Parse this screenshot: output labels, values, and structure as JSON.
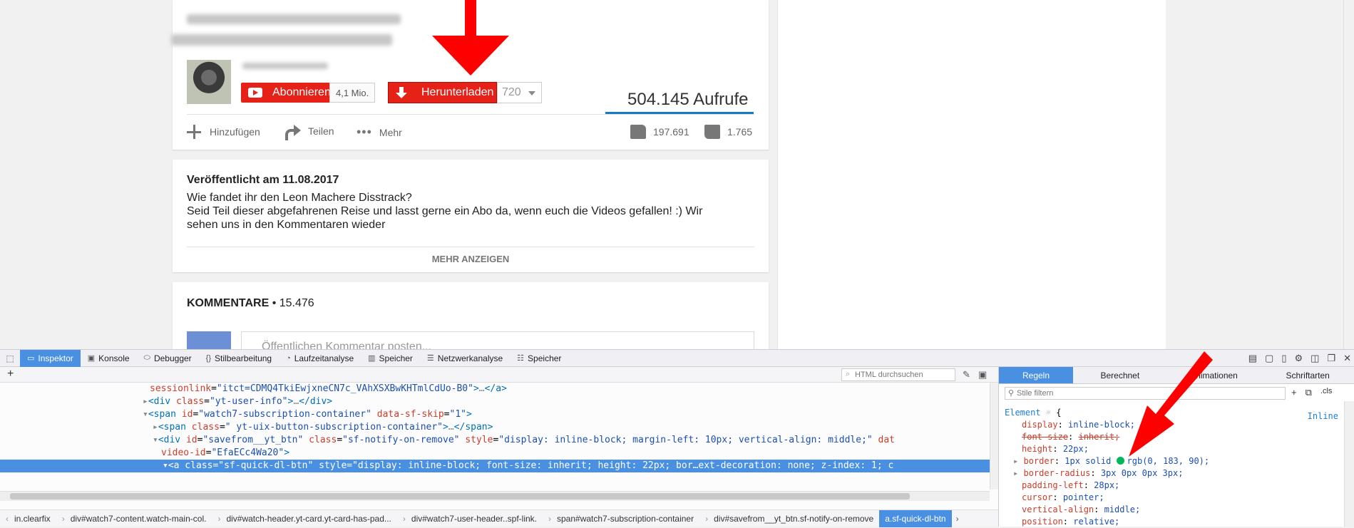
{
  "video": {
    "subscribe_label": "Abonnieren",
    "subscriber_count": "4,1 Mio.",
    "download_label": "Herunterladen",
    "quality": "720",
    "views": "504.145 Aufrufe",
    "actions": {
      "add": "Hinzufügen",
      "share": "Teilen",
      "more": "Mehr"
    },
    "likes": "197.691",
    "dislikes": "1.765"
  },
  "description": {
    "published": "Veröffentlicht am 11.08.2017",
    "line1": "Wie fandet ihr den Leon Machere Disstrack?",
    "line2": "Seid Teil dieser abgefahrenen Reise und lasst gerne ein Abo da, wenn euch die Videos gefallen! :) Wir sehen uns in den Kommentaren wieder",
    "show_more": "MEHR ANZEIGEN"
  },
  "comments": {
    "title": "KOMMENTARE",
    "count": " • 15.476",
    "placeholder": "Öffentlichen Kommentar posten..."
  },
  "devtools": {
    "tabs": [
      "Inspektor",
      "Konsole",
      "Debugger",
      "Stilbearbeitung",
      "Laufzeitanalyse",
      "Speicher",
      "Netzwerkanalyse",
      "Speicher"
    ],
    "tab_icons": [
      "inspector-icon",
      "console-icon",
      "debugger-icon",
      "style-editor-icon",
      "performance-icon",
      "memory-icon",
      "network-icon",
      "storage-icon"
    ],
    "html_search_placeholder": "HTML durchsuchen",
    "breadcrumbs": [
      "in.clearfix",
      "div#watch7-content.watch-main-col.",
      "div#watch-header.yt-card.yt-card-has-pad...",
      "div#watch7-user-header..spf-link.",
      "span#watch7-subscription-container",
      "div#savefrom__yt_btn.sf-notify-on-remove",
      "a.sf-quick-dl-btn"
    ],
    "rules_tabs": [
      "Regeln",
      "Berechnet",
      "Animationen",
      "Schriftarten"
    ],
    "filter_placeholder": "Stile filtern",
    "filter_cls": ".cls",
    "element_label": "Element",
    "inline_label": "Inline",
    "css_rules": [
      {
        "prop": "display",
        "value": "inline-block;"
      },
      {
        "prop": "font-size",
        "value": "inherit;",
        "overridden": true
      },
      {
        "prop": "height",
        "value": "22px;"
      },
      {
        "prop": "border",
        "value": "1px solid",
        "color_value": "rgb(0, 183, 90);",
        "expandable": true
      },
      {
        "prop": "border-radius",
        "value": "3px 0px 0px 3px;",
        "expandable": true
      },
      {
        "prop": "padding-left",
        "value": "28px;"
      },
      {
        "prop": "cursor",
        "value": "pointer;"
      },
      {
        "prop": "vertical-align",
        "value": "middle;"
      },
      {
        "prop": "position",
        "value": "relative;"
      }
    ],
    "code_lines": {
      "l1_attr": "sessionlink",
      "l1_val": "\"itct=CDMQ4TkiEwjxneCN7c_VAhXSXBwKHTmlCdUo-B0\"",
      "l2_open": "<div",
      "l2_attr": "class",
      "l2_val": "\"yt-user-info\"",
      "l2_close": "</div>",
      "l3_open": "<span",
      "l3_attr1": "id",
      "l3_val1": "\"watch7-subscription-container\"",
      "l3_attr2": "data-sf-skip",
      "l3_val2": "\"1\"",
      "l4_open": "<span",
      "l4_attr": "class",
      "l4_val": "\" yt-uix-button-subscription-container\"",
      "l4_close": "</span>",
      "l5_open": "<div",
      "l5_attr1": "id",
      "l5_val1": "\"savefrom__yt_btn\"",
      "l5_attr2": "class",
      "l5_val2": "\"sf-notify-on-remove\"",
      "l5_attr3": "style",
      "l5_val3": "\"display: inline-block; margin-left: 10px; vertical-align: middle;\"",
      "l5_attr4": "dat",
      "l6_attr": "video-id",
      "l6_val": "\"EfaECc4Wa20\"",
      "l7_text": "<a class=\"sf-quick-dl-btn\" style=\"display: inline-block; font-size: inherit; height: 22px; bor…ext-decoration: none; z-index: 1; c"
    },
    "accent_color": "#4a90e2"
  },
  "colors": {
    "youtube_red": "#e62117",
    "views_bar": "#167ac6",
    "arrow_red": "#ff0000"
  }
}
